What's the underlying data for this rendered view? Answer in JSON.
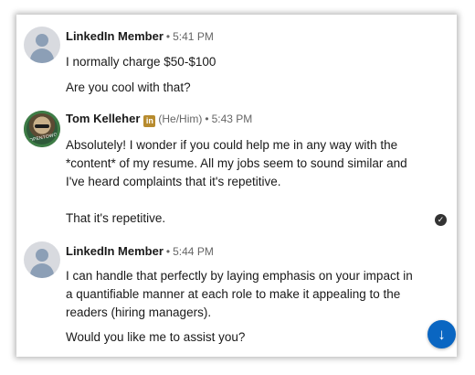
{
  "messages": [
    {
      "sender": "LinkedIn Member",
      "time": "5:41 PM",
      "dot": "•",
      "lines": [
        "I normally charge $50-$100",
        "Are you cool with that?"
      ]
    },
    {
      "sender": "Tom Kelleher",
      "badge": "in",
      "pronouns": "(He/Him)",
      "time": "5:43 PM",
      "dot": "•",
      "avatar_text": "#OPENTOWORK",
      "lines": [
        "Absolutely!  I wonder if you could help me in any way with the *content* of my resume. All my jobs seem to sound similar and I've heard complaints that it's repetitive.",
        "That it's repetitive."
      ]
    },
    {
      "sender": "LinkedIn Member",
      "time": "5:44 PM",
      "dot": "•",
      "lines": [
        "I can handle that perfectly by laying emphasis on your impact in a quantifiable manner at each role to make it appealing to the readers (hiring managers).",
        "Would you like me to assist you?"
      ]
    }
  ],
  "icons": {
    "seen": "check-circle-icon",
    "scroll": "arrow-down-icon",
    "seen_glyph": "✓",
    "scroll_glyph": "↓"
  },
  "colors": {
    "accent": "#0a66c2",
    "premium_badge": "#b78b2e"
  }
}
